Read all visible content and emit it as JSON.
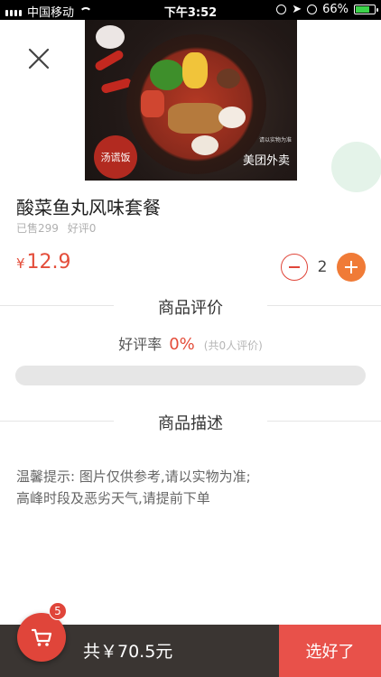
{
  "status_bar": {
    "carrier": "中国移动",
    "time": "下午3:52",
    "battery": "66%",
    "battery_level": 0.66
  },
  "hero": {
    "logo_text": "汤谎饭",
    "brand_text": "美团外卖",
    "tag_text": "请以实物为准"
  },
  "product": {
    "title": "酸菜鱼丸风味套餐",
    "sold": "已售299",
    "good_reviews": "好评0",
    "price_symbol": "¥",
    "price": "12.9",
    "quantity": "2"
  },
  "reviews": {
    "header": "商品评价",
    "rate_label": "好评率",
    "rate_value": "0%",
    "count_text": "(共0人评价)",
    "rate_fraction": 0
  },
  "description": {
    "header": "商品描述",
    "line1": "温馨提示: 图片仅供参考,请以实物为准;",
    "line2": "高峰时段及恶劣天气,请提前下单"
  },
  "cart": {
    "badge_count": "5",
    "total_label": "共￥70.5元",
    "checkout_label": "选好了"
  },
  "colors": {
    "accent_red": "#e44d3a",
    "plus_orange": "#f07b37",
    "bottom_bar": "#3a3532"
  }
}
